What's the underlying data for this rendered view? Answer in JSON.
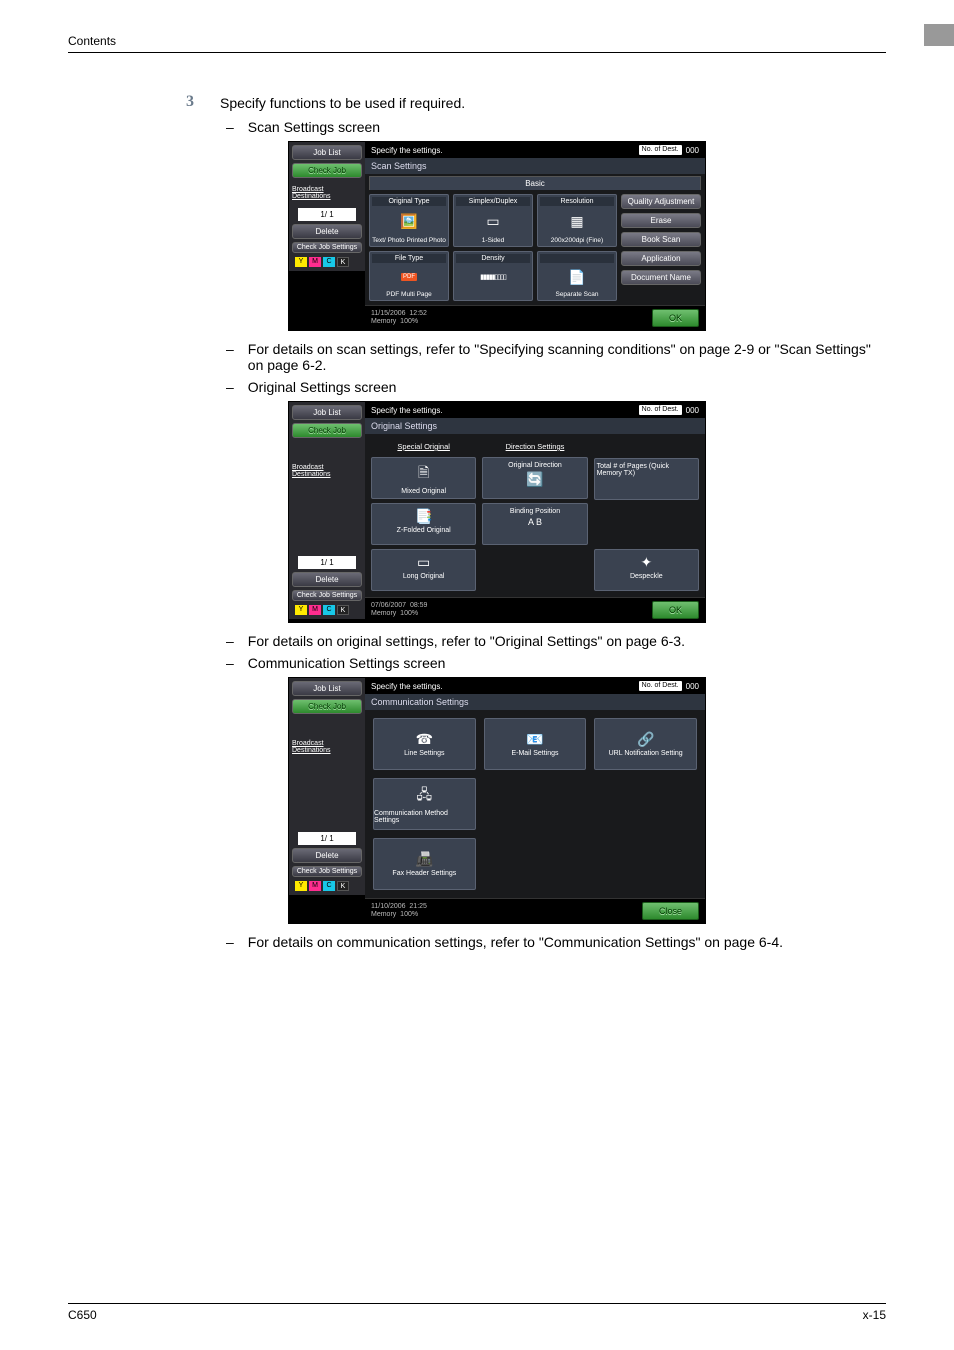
{
  "header": {
    "section": "Contents"
  },
  "footer": {
    "model": "C650",
    "page": "x-15"
  },
  "step": {
    "number": "3",
    "text": "Specify functions to be used if required.",
    "bullets": {
      "b1": "Scan Settings screen",
      "b2": "For details on scan settings, refer to \"Specifying scanning conditions\" on page 2-9 or \"Scan Settings\" on page 6-2.",
      "b3": "Original Settings screen",
      "b4": "For details on original settings, refer to \"Original Settings\" on page 6-3.",
      "b5": "Communication Settings screen",
      "b6": "For details on communication settings, refer to \"Communication Settings\" on page 6-4."
    }
  },
  "common": {
    "job_list": "Job List",
    "check_job": "Check Job",
    "broadcast": "Broadcast Destinations",
    "page_indicator": "1/ 1",
    "delete": "Delete",
    "check_job_settings": "Check Job Settings",
    "toner": {
      "y": "Y",
      "m": "M",
      "c": "C",
      "k": "K"
    },
    "memory_label": "Memory",
    "memory_pct": "100%",
    "specify": "Specify the settings.",
    "no_of_dest": "No. of Dest.",
    "dest_count": "000",
    "ok": "OK",
    "close": "Close"
  },
  "scr1": {
    "title": "Scan Settings",
    "tab": "Basic",
    "date": "11/15/2006",
    "time": "12:52",
    "orig_type": "Original Type",
    "orig_sub": "Text/ Photo Printed Photo",
    "simplex": "Simplex/Duplex",
    "simplex_sub": "1-Sided",
    "resolution": "Resolution",
    "resolution_sub": "200x200dpi (Fine)",
    "filetype": "File Type",
    "filetype_sub": "PDF Multi Page",
    "filetype_badge": "PDF",
    "density": "Density",
    "separate": "Separate Scan",
    "quality": "Quality Adjustment",
    "erase": "Erase",
    "bookscan": "Book Scan",
    "application": "Application",
    "docname": "Document Name"
  },
  "scr2": {
    "title": "Original Settings",
    "date": "07/06/2007",
    "time": "08:59",
    "special": "Special Original",
    "mixed": "Mixed Original",
    "zfold": "Z-Folded Original",
    "long": "Long Original",
    "direction_hdr": "Direction Settings",
    "orig_dir": "Original Direction",
    "binding": "Binding Position",
    "total_pages": "Total # of Pages (Quick Memory TX)",
    "despeckle": "Despeckle"
  },
  "scr3": {
    "title": "Communication Settings",
    "date": "11/10/2006",
    "time": "21:25",
    "line": "Line Settings",
    "email": "E-Mail Settings",
    "url": "URL Notification Setting",
    "comm_method": "Communication Method Settings",
    "fax_header": "Fax Header Settings"
  }
}
